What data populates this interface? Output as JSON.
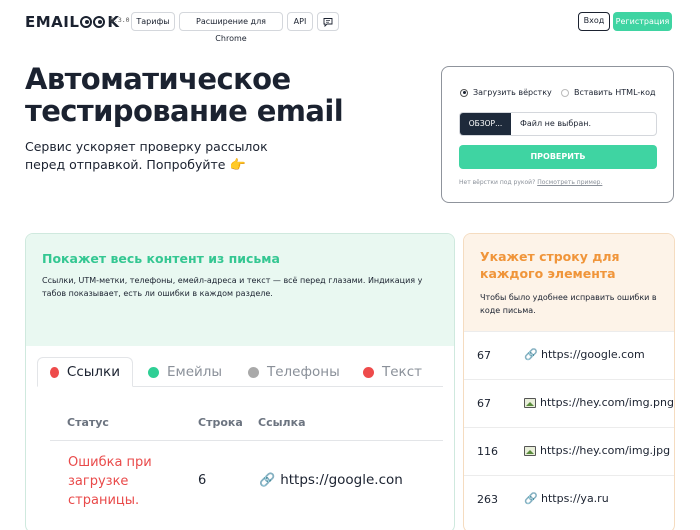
{
  "nav": {
    "logo": "EMAILOOK",
    "logo_prefix": "EMAIL",
    "logo_suffix": "K",
    "version": "0.3.0",
    "items": [
      {
        "label": "Тарифы"
      },
      {
        "label": "Расширение для Chrome"
      },
      {
        "label": "API"
      }
    ],
    "chat_icon": "chat-icon",
    "login_label": "Вход",
    "register_label": "Регистрация"
  },
  "hero": {
    "title": "Автоматическое тестирование email",
    "subtitle": "Сервис ускоряет проверку рассылок перед отправкой. Попробуйте",
    "hand_icon": "👉"
  },
  "upload": {
    "option_upload": "Загрузить вёрстку",
    "option_paste": "Вставить HTML-код",
    "selected": "Загрузить вёрстку",
    "browse_label": "ОБЗОР...",
    "file_placeholder": "Файл не выбран.",
    "check_label": "ПРОВЕРИТЬ",
    "hint_prefix": "Нет вёрстки под рукой?",
    "hint_link": "Посмотреть пример."
  },
  "feature_left": {
    "title": "Покажет весь контент из письма",
    "text": "Ссылки, UTM-метки, телефоны, емейл-адреса и текст — всё перед глазами. Индикация у табов показывает, есть ли ошибки в каждом разделе.",
    "tabs": [
      {
        "label": "Ссылки",
        "color": "#ee4b4b",
        "active": true
      },
      {
        "label": "Емейлы",
        "color": "#2fcf95",
        "active": false
      },
      {
        "label": "Телефоны",
        "color": "#a9a9a9",
        "active": false
      },
      {
        "label": "Текст",
        "color": "#ee4b4b",
        "active": false
      }
    ],
    "table": {
      "headers": [
        "Статус",
        "Строка",
        "Ссылка"
      ],
      "row": {
        "status": "Ошибка при загрузке страницы.",
        "line": "6",
        "link": "https://google.con"
      }
    }
  },
  "feature_right": {
    "title": "Укажет строку для каждого элемента",
    "text": "Чтобы было удобнее исправить ошибки в коде письма.",
    "rows": [
      {
        "line": "67",
        "icon": "link-icon",
        "url": "https://google.com"
      },
      {
        "line": "67",
        "icon": "image-icon",
        "url": "https://hey.com/img.png"
      },
      {
        "line": "116",
        "icon": "image-icon",
        "url": "https://hey.com/img.jpg"
      },
      {
        "line": "263",
        "icon": "link-icon",
        "url": "https://ya.ru"
      }
    ]
  },
  "colors": {
    "accent_green": "#3fd4a2",
    "accent_orange": "#f0953a",
    "error_red": "#e94a4a",
    "dark": "#1b2230"
  }
}
